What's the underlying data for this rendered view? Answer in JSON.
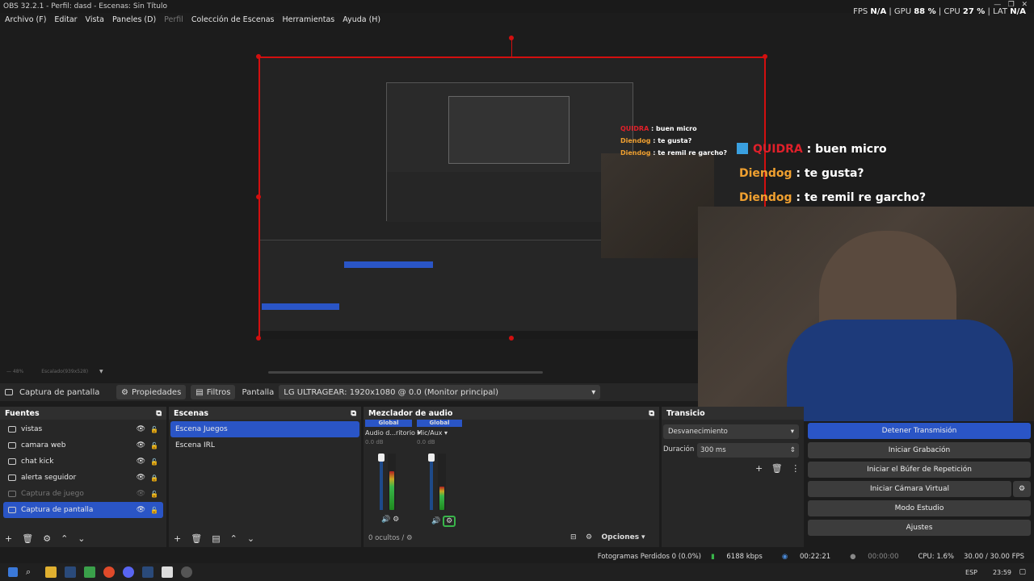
{
  "window": {
    "title": "OBS 32.2.1 - Perfil: dasd - Escenas: Sin Título"
  },
  "stats": {
    "fps_label": "FPS",
    "fps": "N/A",
    "gpu_label": "GPU",
    "gpu": "88 %",
    "cpu_label": "CPU",
    "cpu": "27 %",
    "lat_label": "LAT",
    "lat": "N/A"
  },
  "menu": [
    "Archivo (F)",
    "Editar",
    "Vista",
    "Paneles (D)",
    "Perfil",
    "Colección de Escenas",
    "Herramientas",
    "Ayuda (H)"
  ],
  "chat": [
    {
      "user": "QUIDRA",
      "msg": " : buen micro",
      "color": "#e0202a"
    },
    {
      "user": "Diendog",
      "msg": " : te gusta?",
      "color": "#f0a030"
    },
    {
      "user": "Diendog",
      "msg": " : te remil re garcho?",
      "color": "#f0a030"
    }
  ],
  "preview": {
    "zoom": "48%",
    "scaled": "Escalado(939x528)"
  },
  "props_bar": {
    "source_name": "Captura de pantalla",
    "properties": "Propiedades",
    "filters": "Filtros",
    "display_label": "Pantalla",
    "display_value": "LG ULTRAGEAR: 1920x1080 @ 0.0 (Monitor principal)"
  },
  "sources": {
    "title": "Fuentes",
    "items": [
      {
        "name": "vistas",
        "visible": true,
        "locked": false,
        "dim": false,
        "selected": false
      },
      {
        "name": "camara web",
        "visible": true,
        "locked": false,
        "dim": false,
        "selected": false
      },
      {
        "name": "chat kick",
        "visible": true,
        "locked": false,
        "dim": false,
        "selected": false
      },
      {
        "name": "alerta seguidor",
        "visible": true,
        "locked": true,
        "dim": false,
        "selected": false
      },
      {
        "name": "Captura de juego",
        "visible": false,
        "locked": false,
        "dim": true,
        "selected": false
      },
      {
        "name": "Captura de pantalla",
        "visible": true,
        "locked": false,
        "dim": false,
        "selected": true
      }
    ]
  },
  "scenes": {
    "title": "Escenas",
    "items": [
      {
        "name": "Escena Juegos",
        "selected": true
      },
      {
        "name": "Escena IRL",
        "selected": false
      }
    ]
  },
  "mixer": {
    "title": "Mezclador de audio",
    "channels": [
      {
        "tag": "Global",
        "name": "Audio d...ritorio",
        "db": "0.0 dB",
        "level": 0.68
      },
      {
        "tag": "Global",
        "name": "Mic/Aux",
        "db": "0.0 dB",
        "level": 0.42
      }
    ],
    "hidden": "0 ocultos",
    "options": "Opciones"
  },
  "transitions": {
    "title": "Transicio",
    "type": "Desvanecimiento",
    "duration_label": "Duración",
    "duration": "300 ms"
  },
  "controls": {
    "stop_stream": "Detener Transmisión",
    "start_rec": "Iniciar Grabación",
    "replay": "Iniciar el Búfer de Repetición",
    "vcam": "Iniciar Cámara Virtual",
    "studio": "Modo Estudio",
    "settings": "Ajustes"
  },
  "status": {
    "dropped": "Fotogramas Perdidos 0 (0.0%)",
    "kbps": "6188 kbps",
    "stream_time": "00:22:21",
    "rec_time": "00:00:00",
    "cpu": "CPU: 1.6%",
    "fps": "30.00 / 30.00 FPS"
  },
  "taskbar": {
    "lang": "ESP",
    "time": "23:59"
  },
  "colors": {
    "accent": "#2a55c6",
    "selection": "#d20f0f",
    "bg": "#1c1c1c"
  }
}
